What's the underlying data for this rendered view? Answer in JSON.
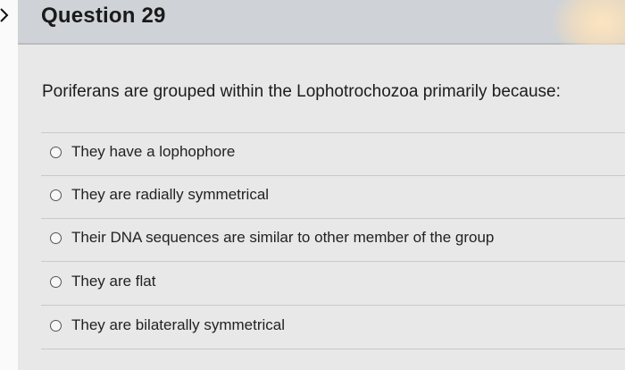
{
  "question": {
    "title": "Question 29",
    "prompt": "Poriferans are grouped within the Lophotrochozoa primarily because:",
    "answers": [
      {
        "label": "They have a lophophore"
      },
      {
        "label": "They are radially symmetrical"
      },
      {
        "label": "Their DNA sequences are similar to other member of the group"
      },
      {
        "label": "They are flat"
      },
      {
        "label": "They are bilaterally symmetrical"
      }
    ]
  },
  "icons": {
    "collapse": "chevron-right-icon"
  },
  "colors": {
    "header_bg": "#cfd2d6",
    "body_bg": "#e8e8e8"
  }
}
